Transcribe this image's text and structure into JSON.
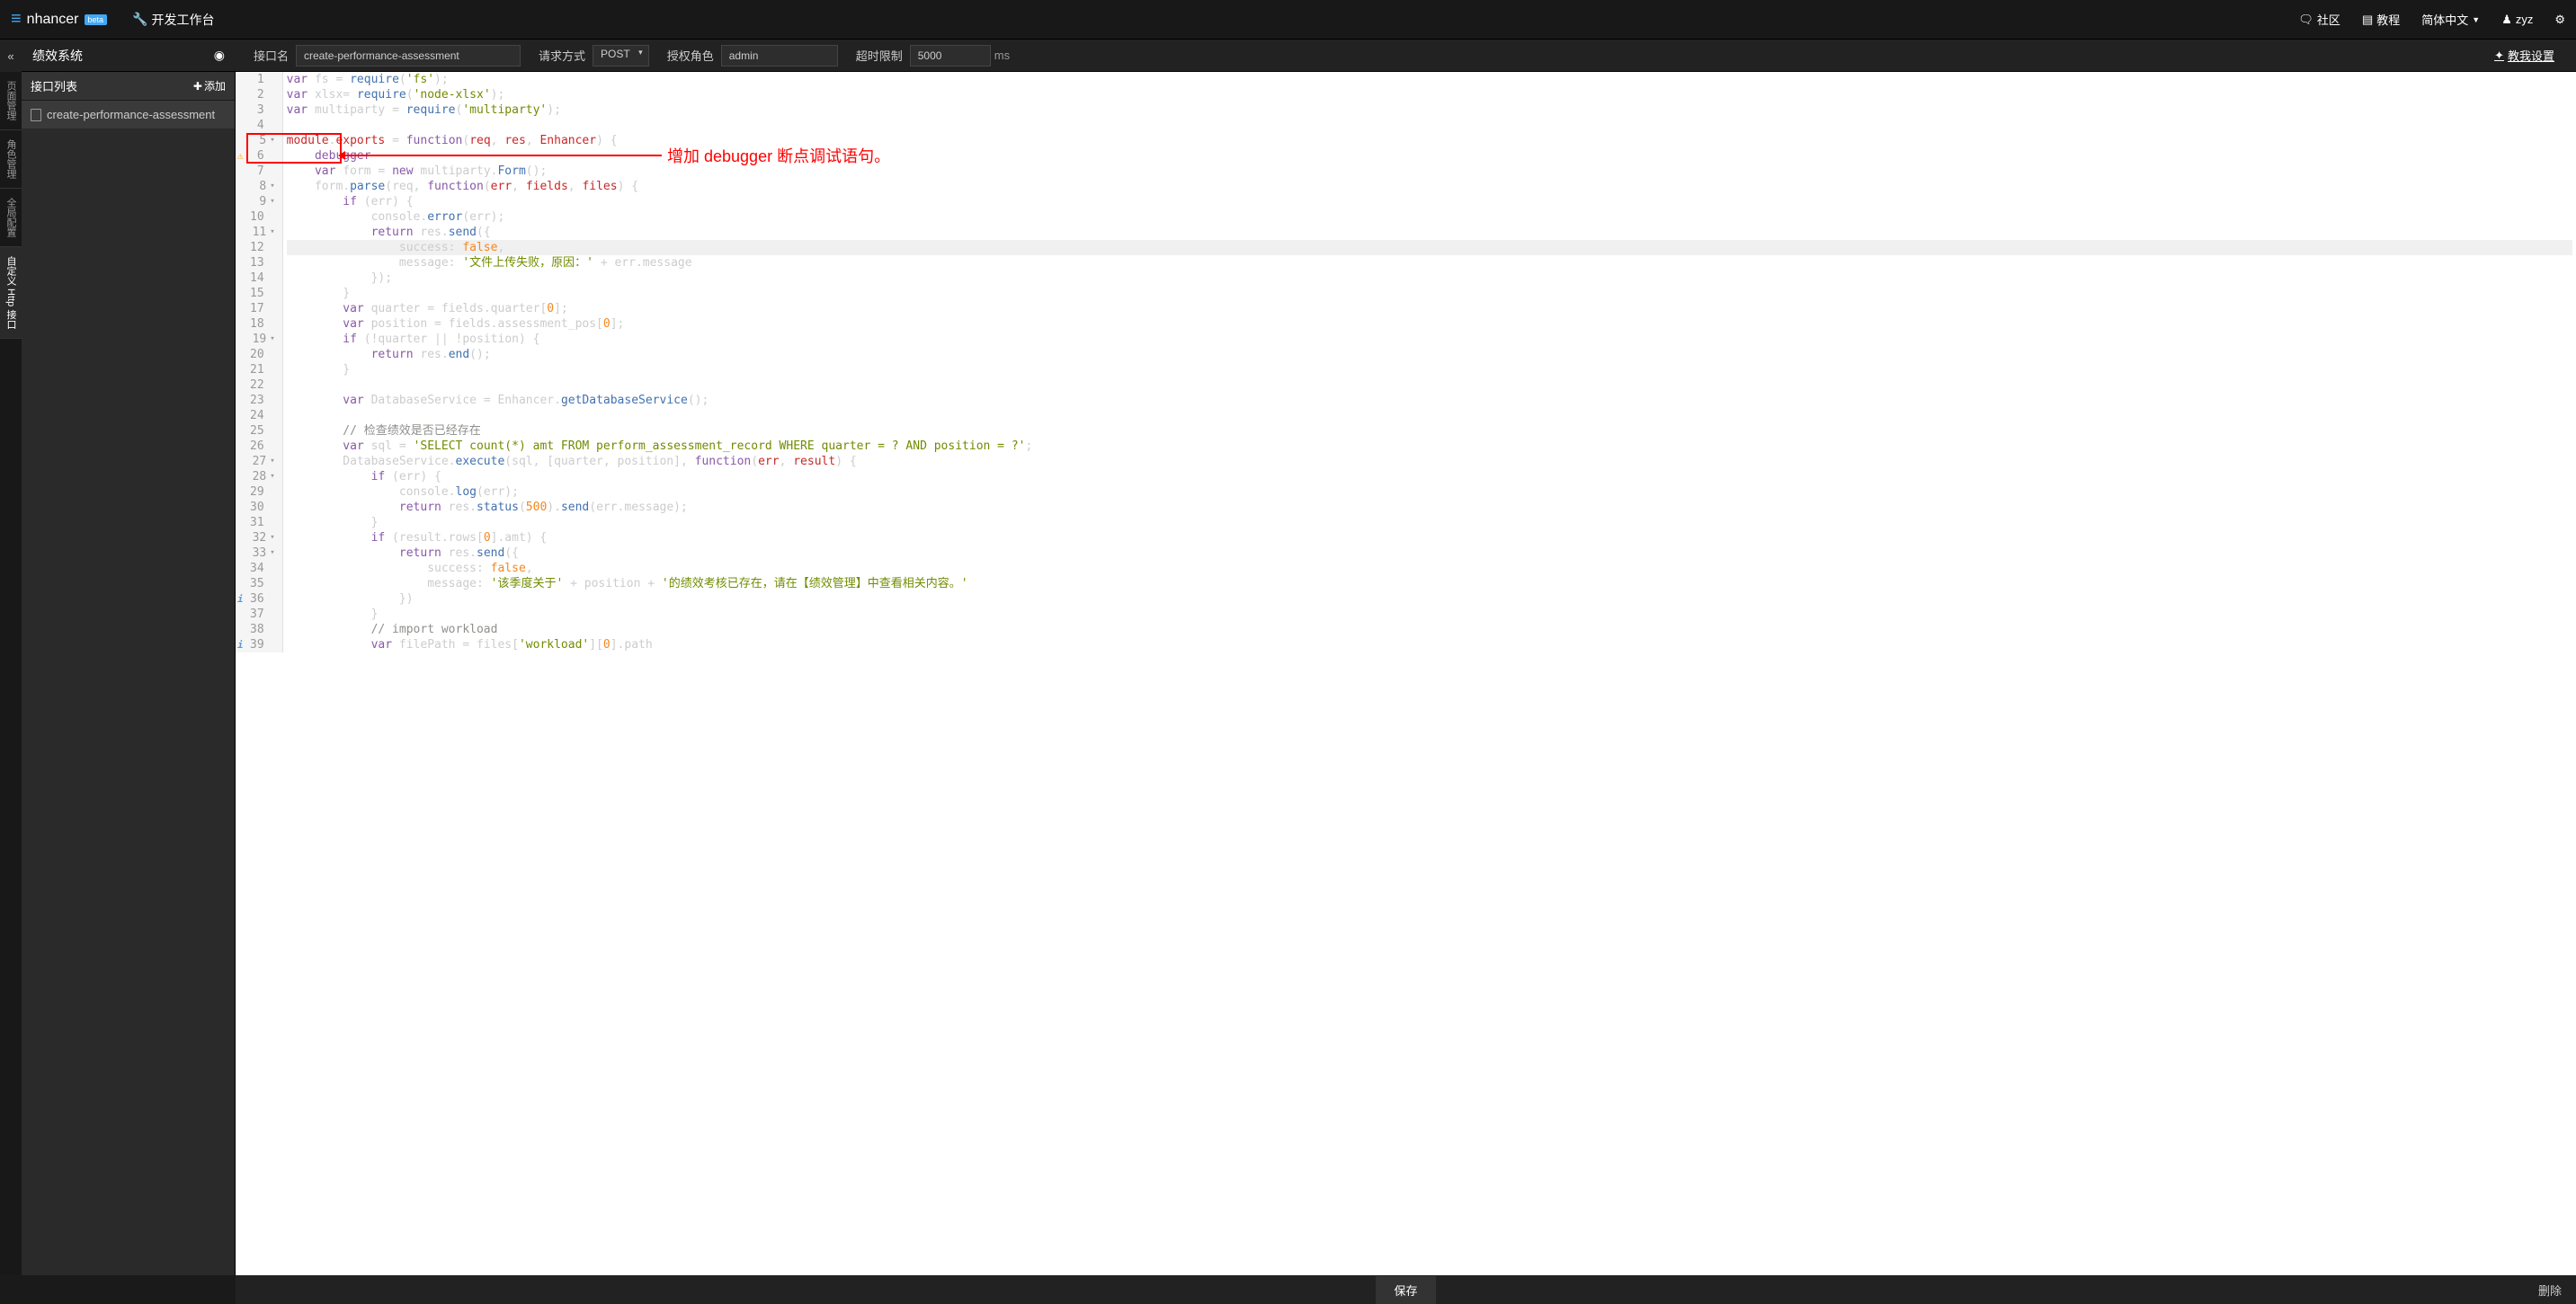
{
  "header": {
    "logo": "nhancer",
    "beta": "beta",
    "workbench": "开发工作台",
    "community": "社区",
    "tutorial": "教程",
    "language": "简体中文",
    "user": "zyz"
  },
  "toolbar": {
    "project_title": "绩效系统",
    "api_name_label": "接口名",
    "api_name_value": "create-performance-assessment",
    "method_label": "请求方式",
    "method_value": "POST",
    "role_label": "授权角色",
    "role_value": "admin",
    "timeout_label": "超时限制",
    "timeout_value": "5000",
    "timeout_unit": "ms",
    "teach_me": "教我设置"
  },
  "vtabs": [
    "页面管理",
    "角色管理",
    "全局配置",
    "自定义 Http 接口"
  ],
  "sidebar": {
    "title": "接口列表",
    "add": "添加",
    "items": [
      "create-performance-assessment"
    ]
  },
  "annotation": "增加 debugger 断点调试语句。",
  "code": {
    "lines": [
      {
        "n": 1,
        "t": [
          [
            "kw",
            "var"
          ],
          [
            "",
            " fs "
          ],
          [
            "",
            "="
          ],
          [
            "",
            " "
          ],
          [
            "fn",
            "require"
          ],
          [
            "",
            "("
          ],
          [
            "str",
            "'fs'"
          ],
          [
            "",
            ");"
          ]
        ]
      },
      {
        "n": 2,
        "t": [
          [
            "kw",
            "var"
          ],
          [
            "",
            " xlsx"
          ],
          [
            "",
            "="
          ],
          [
            "",
            " "
          ],
          [
            "fn",
            "require"
          ],
          [
            "",
            "("
          ],
          [
            "str",
            "'node-xlsx'"
          ],
          [
            "",
            ");"
          ]
        ]
      },
      {
        "n": 3,
        "t": [
          [
            "kw",
            "var"
          ],
          [
            "",
            " multiparty "
          ],
          [
            "",
            "="
          ],
          [
            "",
            " "
          ],
          [
            "fn",
            "require"
          ],
          [
            "",
            "("
          ],
          [
            "str",
            "'multiparty'"
          ],
          [
            "",
            ");"
          ]
        ]
      },
      {
        "n": 4,
        "t": [
          [
            "",
            ""
          ]
        ]
      },
      {
        "n": 5,
        "fold": true,
        "t": [
          [
            "ident",
            "module"
          ],
          [
            "",
            "."
          ],
          [
            "ident",
            "exports"
          ],
          [
            "",
            " "
          ],
          [
            "",
            "="
          ],
          [
            "",
            " "
          ],
          [
            "kw",
            "function"
          ],
          [
            "",
            "("
          ],
          [
            "param",
            "req"
          ],
          [
            "",
            ", "
          ],
          [
            "param",
            "res"
          ],
          [
            "",
            ", "
          ],
          [
            "param",
            "Enhancer"
          ],
          [
            "",
            ") {"
          ]
        ]
      },
      {
        "n": 6,
        "warn": true,
        "t": [
          [
            "",
            "    "
          ],
          [
            "kw",
            "debugger"
          ]
        ]
      },
      {
        "n": 7,
        "t": [
          [
            "",
            "    "
          ],
          [
            "kw",
            "var"
          ],
          [
            "",
            " form "
          ],
          [
            "",
            "="
          ],
          [
            "",
            " "
          ],
          [
            "kw",
            "new"
          ],
          [
            "",
            " multiparty."
          ],
          [
            "fn",
            "Form"
          ],
          [
            "",
            "();"
          ]
        ]
      },
      {
        "n": 8,
        "fold": true,
        "t": [
          [
            "",
            "    form."
          ],
          [
            "fn",
            "parse"
          ],
          [
            "",
            "(req, "
          ],
          [
            "kw",
            "function"
          ],
          [
            "",
            "("
          ],
          [
            "param",
            "err"
          ],
          [
            "",
            ", "
          ],
          [
            "param",
            "fields"
          ],
          [
            "",
            ", "
          ],
          [
            "param",
            "files"
          ],
          [
            "",
            ") {"
          ]
        ]
      },
      {
        "n": 9,
        "fold": true,
        "t": [
          [
            "",
            "        "
          ],
          [
            "kw",
            "if"
          ],
          [
            "",
            " (err) {"
          ]
        ]
      },
      {
        "n": 10,
        "t": [
          [
            "",
            "            console."
          ],
          [
            "fn",
            "error"
          ],
          [
            "",
            "(err);"
          ]
        ]
      },
      {
        "n": 11,
        "fold": true,
        "t": [
          [
            "",
            "            "
          ],
          [
            "kw",
            "return"
          ],
          [
            "",
            " res."
          ],
          [
            "fn",
            "send"
          ],
          [
            "",
            "({"
          ]
        ]
      },
      {
        "n": 12,
        "hl": true,
        "t": [
          [
            "",
            "                success: "
          ],
          [
            "num",
            "false"
          ],
          [
            "",
            ","
          ]
        ]
      },
      {
        "n": 13,
        "t": [
          [
            "",
            "                message: "
          ],
          [
            "str",
            "'文件上传失败，原因：'"
          ],
          [
            "",
            " "
          ],
          [
            "",
            "+"
          ],
          [
            "",
            " err.message"
          ]
        ]
      },
      {
        "n": 14,
        "t": [
          [
            "",
            "            });"
          ]
        ]
      },
      {
        "n": 15,
        "t": [
          [
            "",
            "        }"
          ]
        ]
      },
      {
        "n": 17,
        "t": [
          [
            "",
            "        "
          ],
          [
            "kw",
            "var"
          ],
          [
            "",
            " quarter "
          ],
          [
            "",
            "="
          ],
          [
            "",
            " fields.quarter["
          ],
          [
            "num",
            "0"
          ],
          [
            "",
            "];"
          ]
        ]
      },
      {
        "n": 18,
        "t": [
          [
            "",
            "        "
          ],
          [
            "kw",
            "var"
          ],
          [
            "",
            " position "
          ],
          [
            "",
            "="
          ],
          [
            "",
            " fields.assessment_pos["
          ],
          [
            "num",
            "0"
          ],
          [
            "",
            "];"
          ]
        ]
      },
      {
        "n": 19,
        "fold": true,
        "t": [
          [
            "",
            "        "
          ],
          [
            "kw",
            "if"
          ],
          [
            "",
            " ("
          ],
          [
            "",
            "!"
          ],
          [
            "",
            "quarter "
          ],
          [
            "",
            "||"
          ],
          [
            "",
            " "
          ],
          [
            "",
            "!"
          ],
          [
            "",
            "position) {"
          ]
        ]
      },
      {
        "n": 20,
        "t": [
          [
            "",
            "            "
          ],
          [
            "kw",
            "return"
          ],
          [
            "",
            " res."
          ],
          [
            "fn",
            "end"
          ],
          [
            "",
            "();"
          ]
        ]
      },
      {
        "n": 21,
        "t": [
          [
            "",
            "        }"
          ]
        ]
      },
      {
        "n": 22,
        "t": [
          [
            "",
            ""
          ]
        ]
      },
      {
        "n": 23,
        "t": [
          [
            "",
            "        "
          ],
          [
            "kw",
            "var"
          ],
          [
            "",
            " DatabaseService "
          ],
          [
            "",
            "="
          ],
          [
            "",
            " Enhancer."
          ],
          [
            "fn",
            "getDatabaseService"
          ],
          [
            "",
            "();"
          ]
        ]
      },
      {
        "n": 24,
        "t": [
          [
            "",
            ""
          ]
        ]
      },
      {
        "n": 25,
        "t": [
          [
            "",
            "        "
          ],
          [
            "comm",
            "// 检查绩效是否已经存在"
          ]
        ]
      },
      {
        "n": 26,
        "t": [
          [
            "",
            "        "
          ],
          [
            "kw",
            "var"
          ],
          [
            "",
            " sql "
          ],
          [
            "",
            "="
          ],
          [
            "",
            " "
          ],
          [
            "str",
            "'SELECT count(*) amt FROM perform_assessment_record WHERE quarter = ? AND position = ?'"
          ],
          [
            "",
            ";"
          ]
        ]
      },
      {
        "n": 27,
        "fold": true,
        "t": [
          [
            "",
            "        DatabaseService."
          ],
          [
            "fn",
            "execute"
          ],
          [
            "",
            "(sql, [quarter, position], "
          ],
          [
            "kw",
            "function"
          ],
          [
            "",
            "("
          ],
          [
            "param",
            "err"
          ],
          [
            "",
            ", "
          ],
          [
            "param",
            "result"
          ],
          [
            "",
            ") {"
          ]
        ]
      },
      {
        "n": 28,
        "fold": true,
        "t": [
          [
            "",
            "            "
          ],
          [
            "kw",
            "if"
          ],
          [
            "",
            " (err) {"
          ]
        ]
      },
      {
        "n": 29,
        "t": [
          [
            "",
            "                console."
          ],
          [
            "fn",
            "log"
          ],
          [
            "",
            "(err);"
          ]
        ]
      },
      {
        "n": 30,
        "t": [
          [
            "",
            "                "
          ],
          [
            "kw",
            "return"
          ],
          [
            "",
            " res."
          ],
          [
            "fn",
            "status"
          ],
          [
            "",
            "("
          ],
          [
            "num",
            "500"
          ],
          [
            "",
            ")."
          ],
          [
            "fn",
            "send"
          ],
          [
            "",
            "(err.message);"
          ]
        ]
      },
      {
        "n": 31,
        "t": [
          [
            "",
            "            }"
          ]
        ]
      },
      {
        "n": 32,
        "fold": true,
        "t": [
          [
            "",
            "            "
          ],
          [
            "kw",
            "if"
          ],
          [
            "",
            " (result.rows["
          ],
          [
            "num",
            "0"
          ],
          [
            "",
            "].amt) {"
          ]
        ]
      },
      {
        "n": 33,
        "fold": true,
        "t": [
          [
            "",
            "                "
          ],
          [
            "kw",
            "return"
          ],
          [
            "",
            " res."
          ],
          [
            "fn",
            "send"
          ],
          [
            "",
            "({"
          ]
        ]
      },
      {
        "n": 34,
        "t": [
          [
            "",
            "                    success: "
          ],
          [
            "num",
            "false"
          ],
          [
            "",
            ","
          ]
        ]
      },
      {
        "n": 35,
        "t": [
          [
            "",
            "                    message: "
          ],
          [
            "str",
            "'该季度关于'"
          ],
          [
            "",
            " "
          ],
          [
            "",
            "+"
          ],
          [
            "",
            " position "
          ],
          [
            "",
            "+"
          ],
          [
            "",
            " "
          ],
          [
            "str",
            "'的绩效考核已存在，请在【绩效管理】中查看相关内容。'"
          ]
        ]
      },
      {
        "n": 36,
        "info": true,
        "t": [
          [
            "",
            "                })"
          ]
        ]
      },
      {
        "n": 37,
        "t": [
          [
            "",
            "            }"
          ]
        ]
      },
      {
        "n": 38,
        "t": [
          [
            "",
            "            "
          ],
          [
            "comm",
            "// import workload"
          ]
        ]
      },
      {
        "n": 39,
        "info": true,
        "t": [
          [
            "",
            "            "
          ],
          [
            "kw",
            "var"
          ],
          [
            "",
            " filePath "
          ],
          [
            "",
            "="
          ],
          [
            "",
            " files["
          ],
          [
            "str",
            "'workload'"
          ],
          [
            "",
            "]["
          ],
          [
            "num",
            "0"
          ],
          [
            "",
            "].path"
          ]
        ]
      }
    ]
  },
  "footer": {
    "save": "保存",
    "delete": "删除"
  }
}
